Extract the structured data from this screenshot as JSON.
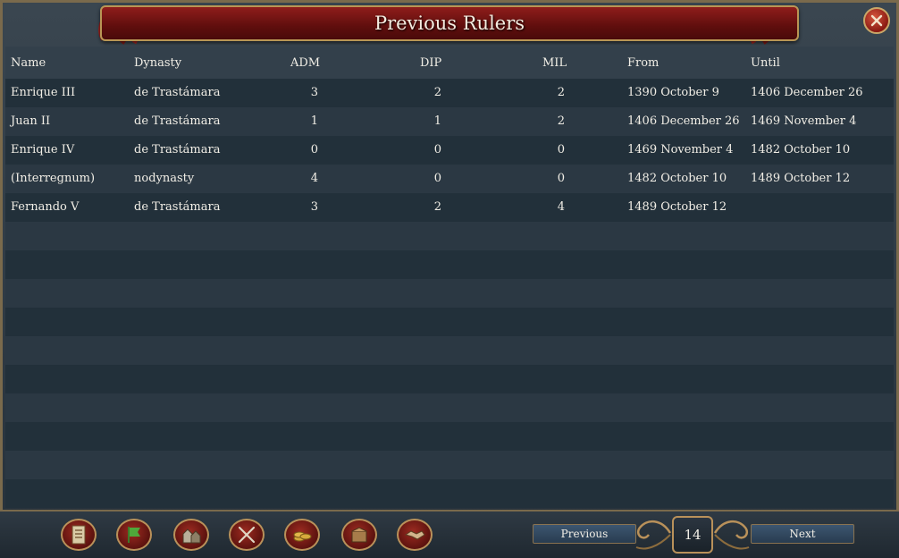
{
  "window": {
    "title": "Previous Rulers"
  },
  "table": {
    "headers": {
      "name": "Name",
      "dynasty": "Dynasty",
      "adm": "ADM",
      "dip": "DIP",
      "mil": "MIL",
      "from": "From",
      "until": "Until"
    },
    "rows": [
      {
        "name": "Enrique III",
        "dynasty": "de Trastámara",
        "adm": "3",
        "dip": "2",
        "mil": "2",
        "from": "1390 October 9",
        "until": "1406 December 26"
      },
      {
        "name": "Juan II",
        "dynasty": "de Trastámara",
        "adm": "1",
        "dip": "1",
        "mil": "2",
        "from": "1406 December 26",
        "until": "1469 November 4"
      },
      {
        "name": "Enrique IV",
        "dynasty": "de Trastámara",
        "adm": "0",
        "dip": "0",
        "mil": "0",
        "from": "1469 November 4",
        "until": "1482 October 10"
      },
      {
        "name": "(Interregnum)",
        "dynasty": "nodynasty",
        "adm": "4",
        "dip": "0",
        "mil": "0",
        "from": "1482 October 10",
        "until": "1489 October 12"
      },
      {
        "name": "Fernando V",
        "dynasty": "de Trastámara",
        "adm": "3",
        "dip": "2",
        "mil": "4",
        "from": "1489 October 12",
        "until": ""
      }
    ]
  },
  "bottom_bar": {
    "icons": [
      "scroll-icon",
      "flag-icon",
      "buildings-icon",
      "crossed-swords-icon",
      "coins-icon",
      "trade-goods-icon",
      "handshake-icon"
    ],
    "previous_label": "Previous",
    "next_label": "Next",
    "page_number": "14"
  },
  "colors": {
    "title_red": "#8f1d1b",
    "gold_border": "#b99655",
    "row_even": "#2b3843",
    "row_odd": "#22303a"
  }
}
